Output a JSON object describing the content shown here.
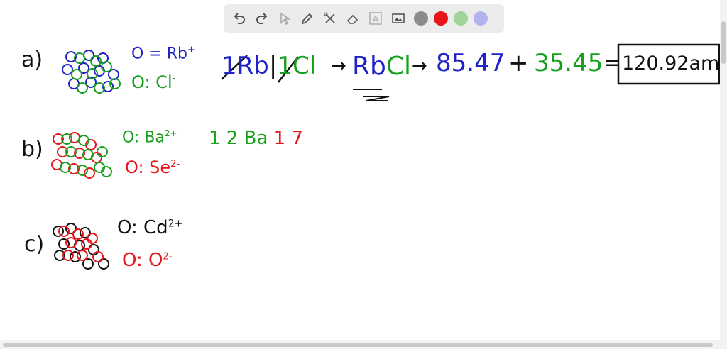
{
  "toolbar": {
    "tools": [
      "undo-icon",
      "redo-icon",
      "pointer-icon",
      "pen-icon",
      "tools-icon",
      "eraser-icon",
      "text-icon",
      "image-icon"
    ],
    "colors": [
      "#8c8c8c",
      "#e8141a",
      "#9fd49a",
      "#b3b3f0"
    ]
  },
  "part_a": {
    "label": "a)",
    "key_blue": "O = Rb",
    "key_blue_sup": "+",
    "key_green": "O: Cl",
    "key_green_sup": "-",
    "eq_rb_1": "1",
    "eq_rb": "Rb",
    "eq_cl_1": "1",
    "eq_cl": "Cl",
    "arrow1": "→",
    "formula_rb": "Rb",
    "formula_cl": "Cl",
    "arrow2": "→",
    "mass_rb": "85.47",
    "plus": "+",
    "mass_cl": "35.45",
    "equals": "=",
    "result": "120.92amu"
  },
  "part_b": {
    "label": "b)",
    "key_green": "O: Ba",
    "key_green_sup": "2+",
    "key_red": "O: Se",
    "key_red_sup": "2-",
    "work": "1 2 Ba",
    "work_red": "1 7"
  },
  "part_c": {
    "label": "c)",
    "key_black": "O: Cd",
    "key_black_sup": "2+",
    "key_red": "O: O",
    "key_red_sup": "2-"
  }
}
